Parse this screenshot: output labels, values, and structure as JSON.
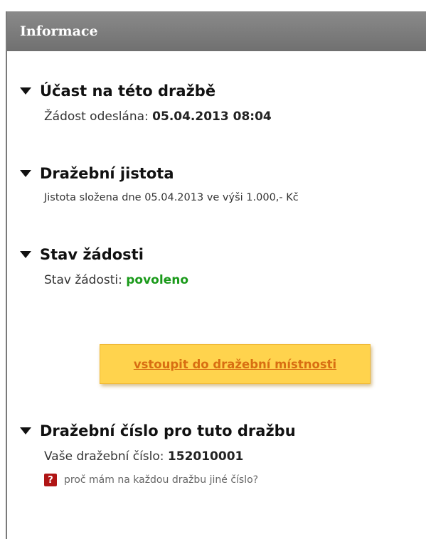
{
  "panel": {
    "title": "Informace"
  },
  "sections": [
    {
      "title": "Účast na této dražbě",
      "label": "Žádost odeslána: ",
      "value": "05.04.2013 08:04"
    },
    {
      "title": "Dražební jistota",
      "text": "Jistota složena dne 05.04.2013 ve výši 1.000,- Kč"
    },
    {
      "title": "Stav žádosti",
      "label": "Stav žádosti: ",
      "value": "povoleno"
    },
    {
      "title": "Dražební číslo pro tuto dražbu",
      "label": "Vaše dražební číslo: ",
      "value": "152010001"
    }
  ],
  "cta": {
    "label": "vstoupit do dražební místnosti"
  },
  "help": {
    "icon": "question-icon",
    "label": "proč mám na každou dražbu jiné číslo?"
  },
  "colors": {
    "header": "#7a7a7a",
    "status": "#1a9a1a",
    "cta_bg": "#ffd34d",
    "cta_text": "#d86e12",
    "help_icon": "#b01515"
  }
}
